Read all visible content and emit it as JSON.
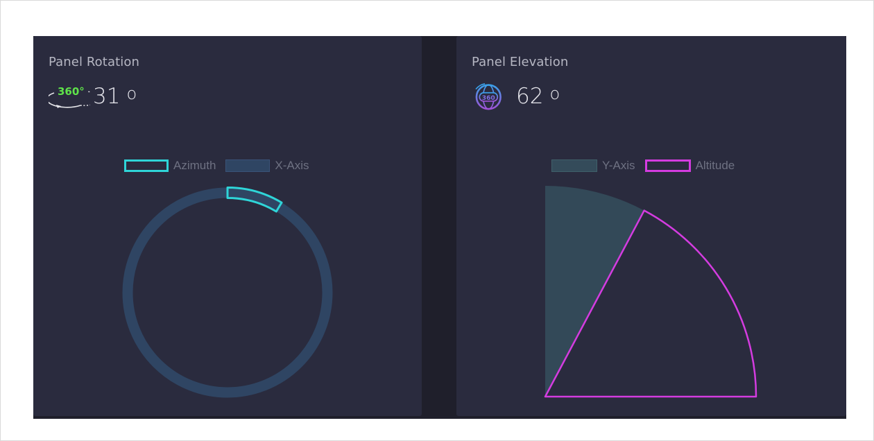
{
  "rotation_panel": {
    "title": "Panel Rotation",
    "value": "31",
    "unit": "o",
    "icon_text": "360°"
  },
  "elevation_panel": {
    "title": "Panel Elevation",
    "value": "62",
    "unit": "o",
    "icon_text": "360"
  },
  "colors": {
    "background": "#2a2b3e",
    "azimuth_stroke": "#2fd5d8",
    "x_axis_fill": "#2f4563",
    "y_axis_fill": "#344b5a",
    "altitude_stroke": "#d43ce0",
    "icon_green": "#5fe34a",
    "icon_purple": "#8f5bd8"
  },
  "chart_data": [
    {
      "type": "pie",
      "subtype": "doughnut",
      "legend": [
        {
          "label": "Azimuth",
          "style": "outline",
          "color": "#2fd5d8"
        },
        {
          "label": "X-Axis",
          "style": "filled",
          "color": "#2f4563"
        }
      ],
      "series": [
        {
          "name": "Azimuth",
          "values": [
            31
          ]
        },
        {
          "name": "X-Axis",
          "values": [
            360
          ]
        }
      ],
      "unit": "degrees",
      "legend_position": "top"
    },
    {
      "type": "pie",
      "subtype": "quarter-sector",
      "legend": [
        {
          "label": "Y-Axis",
          "style": "filled",
          "color": "#344b5a"
        },
        {
          "label": "Altitude",
          "style": "outline",
          "color": "#d43ce0"
        }
      ],
      "series": [
        {
          "name": "Y-Axis",
          "values": [
            90
          ]
        },
        {
          "name": "Altitude",
          "values": [
            62
          ]
        }
      ],
      "unit": "degrees",
      "legend_position": "top"
    }
  ]
}
